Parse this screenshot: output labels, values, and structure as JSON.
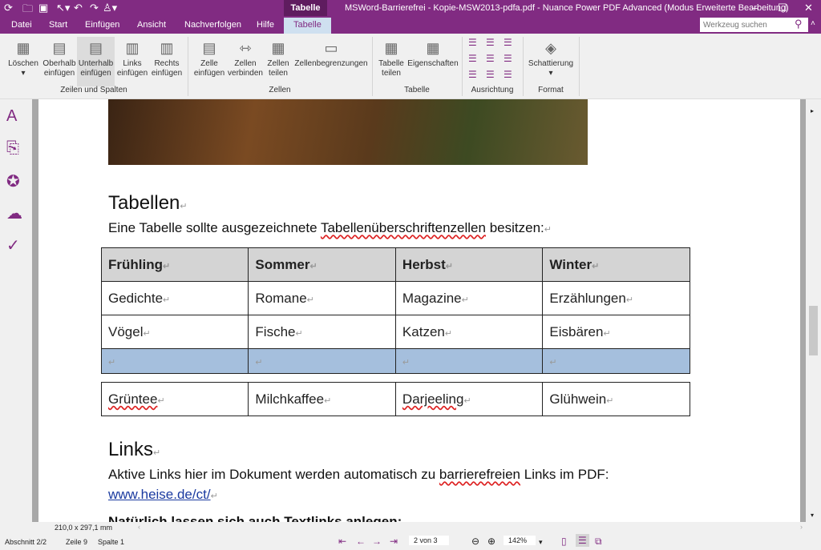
{
  "title_bar": {
    "context_tab": "Tabelle",
    "window_title": "MSWord-Barrierefrei - Kopie-MSW2013-pdfa.pdf - Nuance Power PDF Advanced (Modus Erweiterte Bearbeitung)"
  },
  "menu_tabs": [
    "Datei",
    "Start",
    "Einfügen",
    "Ansicht",
    "Nachverfolgen",
    "Hilfe",
    "Tabelle"
  ],
  "search": {
    "placeholder": "Werkzeug suchen"
  },
  "ribbon": {
    "rows_cols": [
      "Löschen",
      "Oberhalb einfügen",
      "Unterhalb einfügen",
      "Links einfügen",
      "Rechts einfügen"
    ],
    "rows_cols_group": "Zeilen und Spalten",
    "cells": [
      "Zelle einfügen",
      "Zellen verbinden",
      "Zellen teilen",
      "Zellenbegrenzungen"
    ],
    "cells_group": "Zellen",
    "table": [
      "Tabelle teilen",
      "Eigenschaften"
    ],
    "table_group": "Tabelle",
    "align_group": "Ausrichtung",
    "format": "Schattierung",
    "format_group": "Format"
  },
  "document": {
    "heading1": "Tabellen",
    "para1_a": "Eine Tabelle sollte ausgezeichnete ",
    "para1_b": "Tabellenüberschriftenzellen",
    "para1_c": " besitzen:",
    "table": {
      "headers": [
        "Frühling",
        "Sommer",
        "Herbst",
        "Winter"
      ],
      "rows": [
        [
          "Gedichte",
          "Romane",
          "Magazine",
          "Erzählungen"
        ],
        [
          "Vögel",
          "Fische",
          "Katzen",
          "Eisbären"
        ],
        [
          "",
          "",
          "",
          ""
        ],
        [
          "Grüntee",
          "Milchkaffee",
          "Darjeeling",
          "Glühwein"
        ]
      ]
    },
    "heading2": "Links",
    "para2_a": "Aktive Links hier im Dokument werden automatisch zu ",
    "para2_b": "barrierefreien",
    "para2_c": " Links im PDF:",
    "link": "www.heise.de/ct/",
    "para3": "Natürlich lassen sich auch Textlinks anlegen:",
    "mark": "↵"
  },
  "page_size": "210,0 x 297,1 mm",
  "status": {
    "section": "Abschnitt 2/2",
    "line": "Zeile 9",
    "column": "Spalte 1",
    "page": "2 von 3",
    "zoom": "142%"
  },
  "colors": {
    "brand": "#812b82",
    "selected_row": "#a5bfdd",
    "header_row": "#d4d4d4"
  }
}
